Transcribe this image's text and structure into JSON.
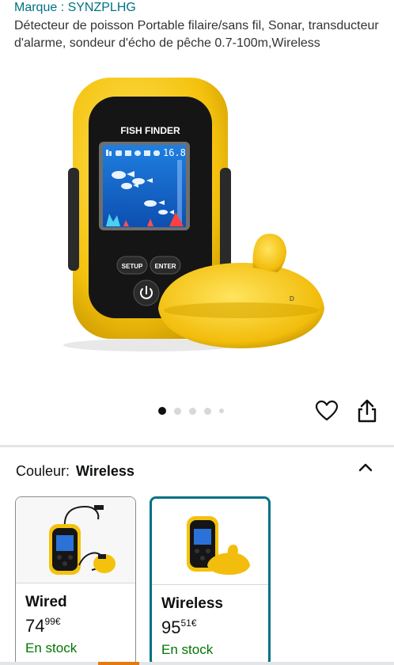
{
  "product": {
    "brand": "Marque : SYNZPLHG",
    "title": "Détecteur de poisson Portable filaire/sans fil, Sonar, transducteur d'alarme, sondeur d'écho de pêche 0.7-100m,Wireless"
  },
  "device": {
    "label": "FISH FINDER",
    "depth_reading": "16.8",
    "setup_label": "SETUP",
    "enter_label": "ENTER",
    "sensor_label": "D"
  },
  "gallery": {
    "image_count": 5,
    "active_index": 0
  },
  "icons": {
    "wishlist": "heart-icon",
    "share": "share-icon",
    "collapse": "chevron-up-icon",
    "power": "power-icon"
  },
  "variation": {
    "label": "Couleur:",
    "selected": "Wireless",
    "options": [
      {
        "name": "Wired",
        "price_whole": "74",
        "price_cents": "99",
        "currency": "€",
        "availability": "En stock"
      },
      {
        "name": "Wireless",
        "price_whole": "95",
        "price_cents": "51",
        "currency": "€",
        "availability": "En stock"
      }
    ]
  },
  "colors": {
    "link": "#007185",
    "in_stock": "#007600",
    "selected_border": "#007185",
    "device_yellow": "#f7c51a",
    "accent_orange": "#e47911"
  }
}
